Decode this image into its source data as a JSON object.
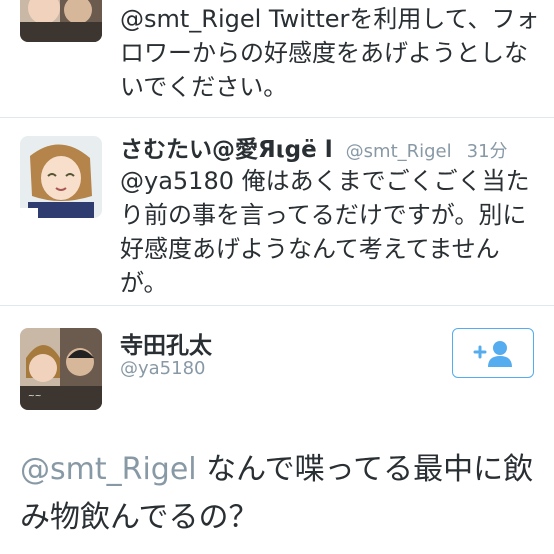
{
  "tweets": [
    {
      "text": "@smt_Rigel Twitterを利用して、フォロワーからの好感度をあげようとしないでください。"
    },
    {
      "display_name": "さむたい@愛Яιgë",
      "screen_name": "@smt_Rigel",
      "time": "31分",
      "text": "@ya5180 俺はあくまでごくごく当たり前の事を言ってるだけですが。別に好感度あげようなんて考えてませんが。"
    }
  ],
  "detail": {
    "display_name": "寺田孔太",
    "screen_name": "@ya5180",
    "mention": "@smt_Rigel",
    "text": " なんで喋ってる最中に飲み物飲んでるの？",
    "follow_icon": "add-user-icon"
  },
  "colors": {
    "accent": "#55acee",
    "secondary_text": "#8899a6",
    "primary_text": "#292f33"
  }
}
